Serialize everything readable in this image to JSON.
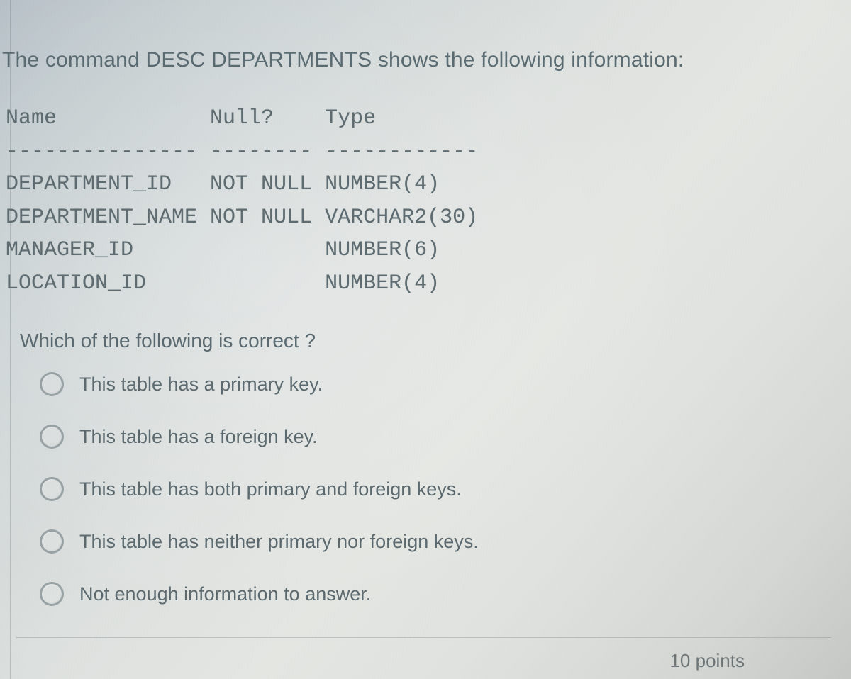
{
  "intro": "The command DESC DEPARTMENTS shows the following information:",
  "table": {
    "headers": {
      "name": "Name",
      "null": "Null?",
      "type": "Type"
    },
    "divider": "--------------- -------- ------------",
    "rows": [
      {
        "name": "DEPARTMENT_ID",
        "null": "NOT NULL",
        "type": "NUMBER(4)"
      },
      {
        "name": "DEPARTMENT_NAME",
        "null": "NOT NULL",
        "type": "VARCHAR2(30)"
      },
      {
        "name": "MANAGER_ID",
        "null": "",
        "type": "NUMBER(6)"
      },
      {
        "name": "LOCATION_ID",
        "null": "",
        "type": "NUMBER(4)"
      }
    ]
  },
  "question": "Which of the following is correct ?",
  "options": [
    "This table has a primary key.",
    "This table has a foreign key.",
    "This table has both primary and foreign keys.",
    "This table has neither primary nor foreign keys.",
    "Not enough information to answer."
  ],
  "points": "10 points"
}
